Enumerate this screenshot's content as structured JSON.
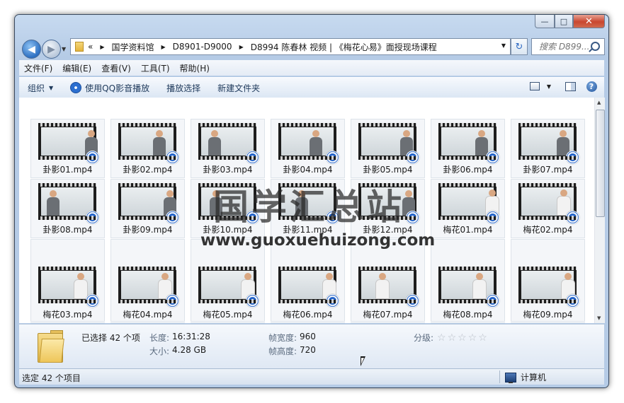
{
  "window": {
    "min_glyph": "—",
    "max_glyph": "□",
    "close_glyph": "✕"
  },
  "address": {
    "prefix": "«",
    "crumbs": [
      "国学资料馆",
      "D8901-D9000",
      "D8994 陈春林 视频 | 《梅花心易》面授现场课程"
    ],
    "refresh_glyph": "↻"
  },
  "search": {
    "placeholder": "搜索 D899..."
  },
  "menubar": {
    "items": [
      "文件(F)",
      "编辑(E)",
      "查看(V)",
      "工具(T)",
      "帮助(H)"
    ]
  },
  "toolbar": {
    "organize": "组织",
    "play_qq": "使用QQ影音播放",
    "play_selected": "播放选择",
    "new_folder": "新建文件夹",
    "help_glyph": "?"
  },
  "files": [
    {
      "name": "卦影01.mp4",
      "presenter": "dark"
    },
    {
      "name": "卦影02.mp4",
      "presenter": "dark"
    },
    {
      "name": "卦影03.mp4",
      "presenter": "dark"
    },
    {
      "name": "卦影04.mp4",
      "presenter": "dark"
    },
    {
      "name": "卦影05.mp4",
      "presenter": "dark"
    },
    {
      "name": "卦影06.mp4",
      "presenter": "dark"
    },
    {
      "name": "卦影07.mp4",
      "presenter": "dark"
    },
    {
      "name": "卦影08.mp4",
      "presenter": "dark"
    },
    {
      "name": "卦影09.mp4",
      "presenter": "dark"
    },
    {
      "name": "卦影10.mp4",
      "presenter": "dark"
    },
    {
      "name": "卦影11.mp4",
      "presenter": "dark"
    },
    {
      "name": "卦影12.mp4",
      "presenter": "dark"
    },
    {
      "name": "梅花01.mp4",
      "presenter": "white"
    },
    {
      "name": "梅花02.mp4",
      "presenter": "white"
    },
    {
      "name": "梅花03.mp4",
      "presenter": "white"
    },
    {
      "name": "梅花04.mp4",
      "presenter": "white"
    },
    {
      "name": "梅花05.mp4",
      "presenter": "white"
    },
    {
      "name": "梅花06.mp4",
      "presenter": "white"
    },
    {
      "name": "梅花07.mp4",
      "presenter": "white"
    },
    {
      "name": "梅花08.mp4",
      "presenter": "white"
    },
    {
      "name": "梅花09.mp4",
      "presenter": "white"
    }
  ],
  "watermark": {
    "cn": "国学汇总站",
    "url": "www.guoxuehuizong.com"
  },
  "details": {
    "selected": "已选择 42 个项",
    "length_label": "长度:",
    "length_value": "16:31:28",
    "size_label": "大小:",
    "size_value": "4.28 GB",
    "frame_width_label": "帧宽度:",
    "frame_width_value": "960",
    "frame_height_label": "帧高度:",
    "frame_height_value": "720",
    "rating_label": "分级:",
    "rating_value": 0,
    "rating_max": 5
  },
  "statusbar": {
    "left": "选定 42 个项目",
    "right": "计算机"
  },
  "colors": {
    "qq_badge": "#1e5fc6",
    "chrome": "#b5cbe6",
    "close": "#c9472f"
  }
}
